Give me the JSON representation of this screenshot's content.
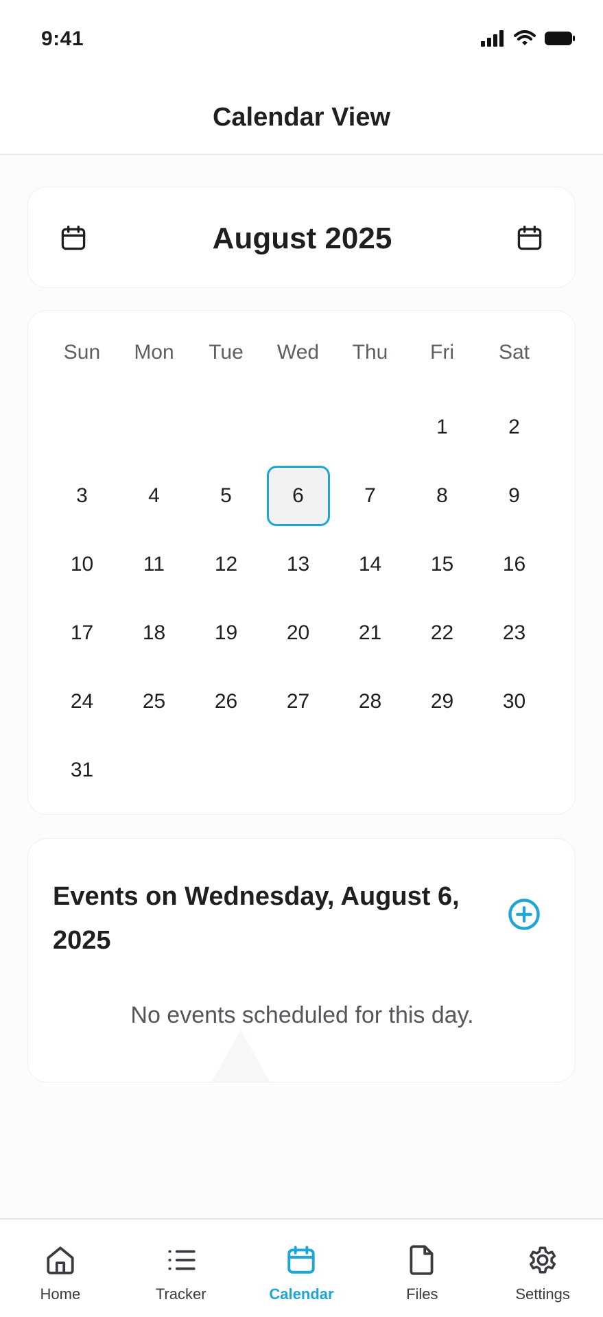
{
  "status_bar": {
    "time": "9:41"
  },
  "header": {
    "title": "Calendar View"
  },
  "month_nav": {
    "label": "August 2025"
  },
  "calendar": {
    "weekdays": [
      "Sun",
      "Mon",
      "Tue",
      "Wed",
      "Thu",
      "Fri",
      "Sat"
    ],
    "selected_day": "6",
    "weeks": [
      [
        "",
        "",
        "",
        "",
        "",
        "1",
        "2"
      ],
      [
        "3",
        "4",
        "5",
        "6",
        "7",
        "8",
        "9"
      ],
      [
        "10",
        "11",
        "12",
        "13",
        "14",
        "15",
        "16"
      ],
      [
        "17",
        "18",
        "19",
        "20",
        "21",
        "22",
        "23"
      ],
      [
        "24",
        "25",
        "26",
        "27",
        "28",
        "29",
        "30"
      ],
      [
        "31",
        "",
        "",
        "",
        "",
        "",
        ""
      ]
    ]
  },
  "events": {
    "title": "Events on Wednesday, August 6, 2025",
    "empty_message": "No events scheduled for this day."
  },
  "bottom_nav": {
    "items": [
      {
        "label": "Home",
        "icon": "home-icon"
      },
      {
        "label": "Tracker",
        "icon": "list-icon"
      },
      {
        "label": "Calendar",
        "icon": "calendar-icon",
        "active": true
      },
      {
        "label": "Files",
        "icon": "file-icon"
      },
      {
        "label": "Settings",
        "icon": "gear-icon"
      }
    ]
  },
  "colors": {
    "accent": "#1ea6d6",
    "text": "#1f1f22",
    "muted": "#5e5e66"
  }
}
